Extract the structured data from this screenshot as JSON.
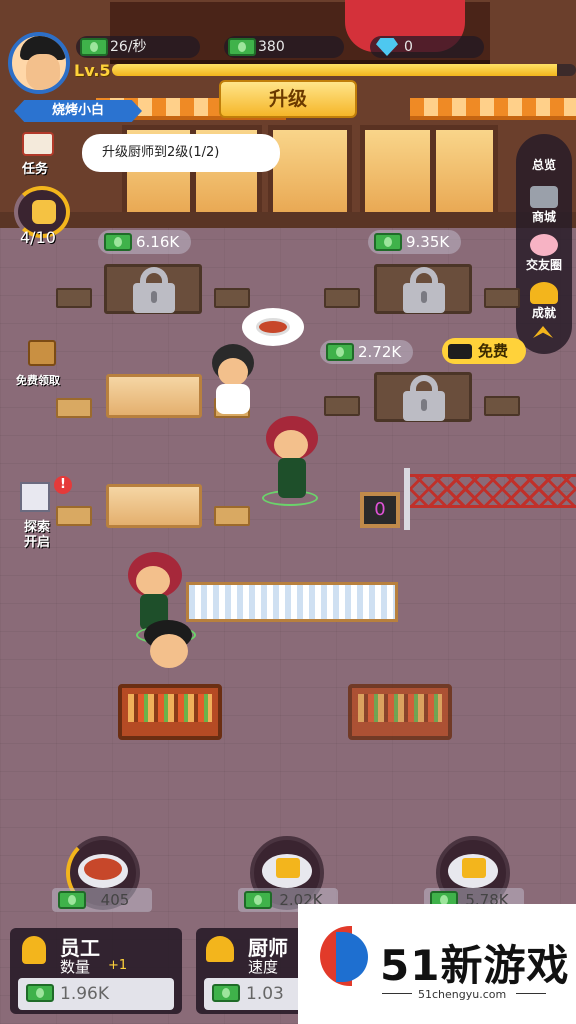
{
  "header": {
    "income_rate": "26/秒",
    "cash": "380",
    "gems": "0",
    "level": "Lv.5",
    "xp_fraction": 0.96,
    "player_name": "烧烤小白",
    "upgrade_label": "升级"
  },
  "task": {
    "label": "任务",
    "text": "升级厨师到2级(1/2)"
  },
  "likes": {
    "count": "4/10"
  },
  "side_nav": {
    "overview": "总览",
    "shop": "商城",
    "friends": "交友圈",
    "achievements": "成就"
  },
  "quick": {
    "free_gift": "免费领取",
    "explore_line1": "探索",
    "explore_line2": "开启",
    "explore_alert": "!"
  },
  "tables": {
    "locked_1_price": "6.16K",
    "locked_2_price": "9.35K",
    "locked_3_price": "2.72K",
    "free_label": "免费"
  },
  "queue_count": "0",
  "dishes": [
    {
      "price": "405",
      "locked": false
    },
    {
      "price": "2.02K",
      "locked": true
    },
    {
      "price": "5.78K",
      "locked": true
    }
  ],
  "upgrades": {
    "staff_title": "员工",
    "staff_sub": "数量",
    "staff_bonus": "+1",
    "staff_cost": "1.96K",
    "chef_title": "厨师",
    "chef_sub": "速度",
    "chef_cost": "1.03"
  },
  "watermark": {
    "brand": "51新游戏",
    "url": "51chengyu.com"
  },
  "colors": {
    "gold": "#f3b51c",
    "brand_blue": "#2b73d0",
    "cash_green": "#3fb24a"
  }
}
